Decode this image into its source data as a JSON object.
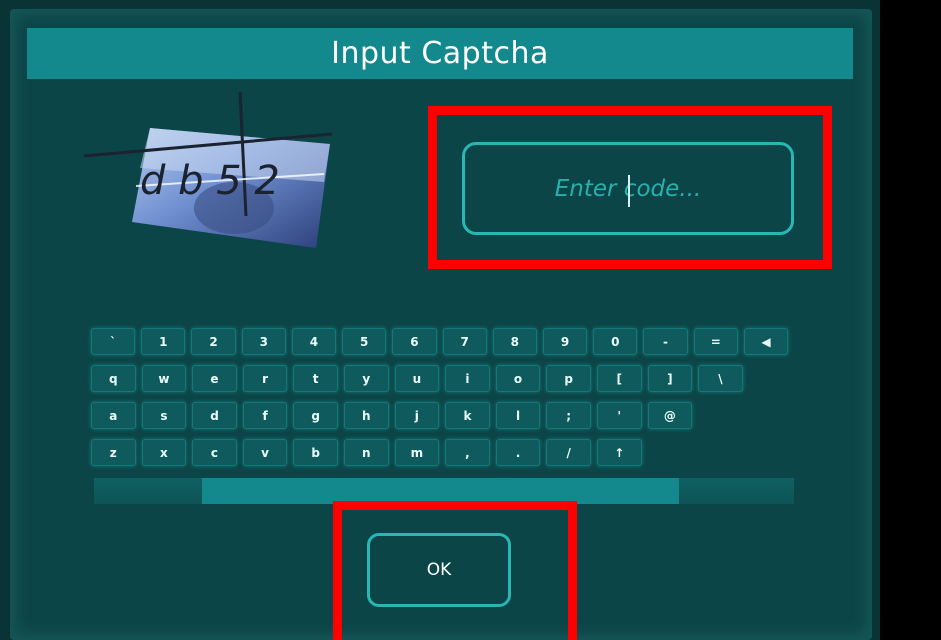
{
  "dialog": {
    "title": "Input Captcha"
  },
  "captcha": {
    "image_text": "db52",
    "colors": {
      "card": "#6f8fd0",
      "card_dark": "#2b3f7a",
      "glyph": "#1c2330"
    }
  },
  "input": {
    "placeholder": "Enter code...",
    "value": ""
  },
  "keyboard": {
    "rows": [
      [
        "`",
        "1",
        "2",
        "3",
        "4",
        "5",
        "6",
        "7",
        "8",
        "9",
        "0",
        "-",
        "=",
        "◀"
      ],
      [
        "q",
        "w",
        "e",
        "r",
        "t",
        "y",
        "u",
        "i",
        "o",
        "p",
        "[",
        "]",
        "\\"
      ],
      [
        "a",
        "s",
        "d",
        "f",
        "g",
        "h",
        "j",
        "k",
        "l",
        ";",
        "'",
        "@"
      ],
      [
        "z",
        "x",
        "c",
        "v",
        "b",
        "n",
        "m",
        ",",
        ".",
        "/",
        "↑"
      ]
    ]
  },
  "ok_button": {
    "label": "OK"
  },
  "colors": {
    "accent": "#2ab7b3",
    "title_bar": "#13888d",
    "background": "#0c4547",
    "highlight": "#ff0000"
  }
}
